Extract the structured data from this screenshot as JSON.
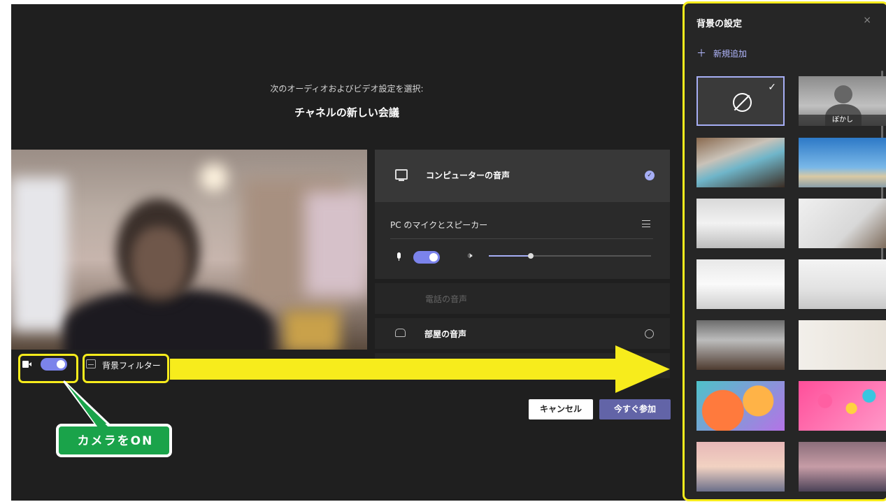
{
  "prejoin": {
    "subtitle": "次のオーディオおよびビデオ設定を選択:",
    "meeting_title": "チャネルの新しい会議",
    "background_filter_label": "背景フィルター"
  },
  "audio_options": {
    "computer_audio": "コンピューターの音声",
    "pc_mic_speaker": "PC のマイクとスピーカー",
    "phone_audio": "電話の音声",
    "room_audio": "部屋の音声",
    "speaker_volume": 0.26
  },
  "buttons": {
    "cancel": "キャンセル",
    "join_now": "今すぐ参加"
  },
  "annotation": {
    "callout": "カメラをON"
  },
  "background_panel": {
    "title": "背景の設定",
    "add_new": "新規追加",
    "close_icon": "×",
    "blur_label": "ぼかし",
    "selected": "none"
  },
  "colors": {
    "accent": "#7b83eb",
    "join_button": "#6264a7",
    "highlight": "#f7ec1c",
    "callout": "#1aa34a"
  }
}
